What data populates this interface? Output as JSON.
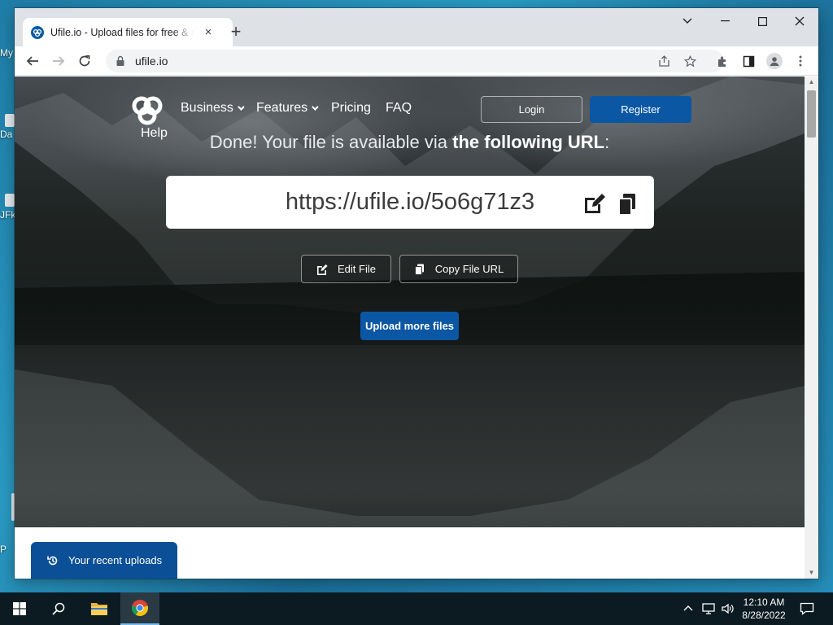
{
  "desktop": {
    "icons": [
      {
        "label": "My"
      },
      {
        "label": "Da"
      },
      {
        "label": "JFk"
      },
      {
        "label": "P"
      }
    ]
  },
  "browser": {
    "tab": {
      "title": "Ufile.io - Upload files for free & s",
      "close": "×"
    },
    "new_tab": "+",
    "controls": {
      "minimize": "—",
      "maximize": "☐",
      "close": "✕",
      "dropdown": "⌄"
    },
    "address": {
      "url": "ufile.io"
    }
  },
  "page": {
    "nav": {
      "logo_help": "Help",
      "links": [
        {
          "label": "Business",
          "dropdown": true
        },
        {
          "label": "Features",
          "dropdown": true
        },
        {
          "label": "Pricing",
          "dropdown": false
        },
        {
          "label": "FAQ",
          "dropdown": false
        }
      ],
      "login": "Login",
      "register": "Register"
    },
    "done": {
      "prefix": "Done! Your file is available via ",
      "emphasis": "the following URL",
      "suffix": ":"
    },
    "file_url": "https://ufile.io/5o6g71z3",
    "buttons": {
      "edit": "Edit File",
      "copy": "Copy File URL",
      "upload_more": "Upload more files"
    },
    "recent_uploads": "Your recent uploads"
  },
  "taskbar": {
    "time": "12:10 AM",
    "date": "8/28/2022"
  },
  "colors": {
    "brand_blue": "#0b57a4",
    "recent_tab": "#0b4f96",
    "taskbar": "#0c1a22"
  }
}
